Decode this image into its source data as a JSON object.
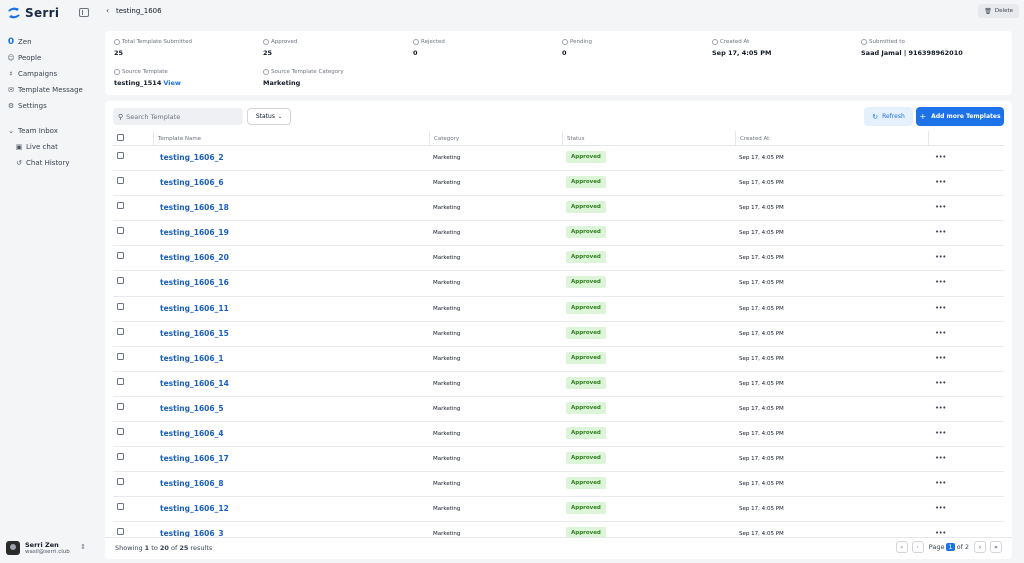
{
  "brand": {
    "name": "Serri",
    "accent": "#1d72e8"
  },
  "sidebar": {
    "items": [
      {
        "label": "Zen",
        "icon": "zen-logo-icon"
      },
      {
        "label": "People",
        "icon": "people-icon"
      },
      {
        "label": "Campaigns",
        "icon": "megaphone-icon"
      },
      {
        "label": "Template Message",
        "icon": "template-icon"
      },
      {
        "label": "Settings",
        "icon": "gear-icon"
      }
    ],
    "group": {
      "label": "Team Inbox",
      "items": [
        {
          "label": "Live chat",
          "icon": "chat-icon"
        },
        {
          "label": "Chat History",
          "icon": "history-icon"
        }
      ]
    },
    "user": {
      "name": "Serri Zen",
      "email": "wasil@serri.club"
    }
  },
  "header": {
    "title": "testing_1606",
    "delete_label": "Delete"
  },
  "summary": {
    "total": {
      "label": "Total Template Submitted",
      "value": "25"
    },
    "approved": {
      "label": "Approved",
      "value": "25"
    },
    "rejected": {
      "label": "Rejected",
      "value": "0"
    },
    "pending": {
      "label": "Pending",
      "value": "0"
    },
    "created": {
      "label": "Created At",
      "value": "Sep 17, 4:05 PM"
    },
    "submitted": {
      "label": "Submitted to",
      "value": "Saad Jamal | 916398962010"
    },
    "source": {
      "label": "Source Template",
      "value": "testing_1514",
      "link": "View"
    },
    "category": {
      "label": "Source Template Category",
      "value": "Marketing"
    }
  },
  "toolbar": {
    "search_placeholder": "Search Template",
    "status_label": "Status",
    "refresh_label": "Refresh",
    "add_label": "Add more Templates"
  },
  "table": {
    "columns": [
      "Template Name",
      "Category",
      "Status",
      "Created At"
    ],
    "rows": [
      {
        "name": "testing_1606_2",
        "category": "Marketing",
        "status": "Approved",
        "created": "Sep 17, 4:05 PM"
      },
      {
        "name": "testing_1606_6",
        "category": "Marketing",
        "status": "Approved",
        "created": "Sep 17, 4:05 PM"
      },
      {
        "name": "testing_1606_18",
        "category": "Marketing",
        "status": "Approved",
        "created": "Sep 17, 4:05 PM"
      },
      {
        "name": "testing_1606_19",
        "category": "Marketing",
        "status": "Approved",
        "created": "Sep 17, 4:05 PM"
      },
      {
        "name": "testing_1606_20",
        "category": "Marketing",
        "status": "Approved",
        "created": "Sep 17, 4:05 PM"
      },
      {
        "name": "testing_1606_16",
        "category": "Marketing",
        "status": "Approved",
        "created": "Sep 17, 4:05 PM"
      },
      {
        "name": "testing_1606_11",
        "category": "Marketing",
        "status": "Approved",
        "created": "Sep 17, 4:05 PM"
      },
      {
        "name": "testing_1606_15",
        "category": "Marketing",
        "status": "Approved",
        "created": "Sep 17, 4:05 PM"
      },
      {
        "name": "testing_1606_1",
        "category": "Marketing",
        "status": "Approved",
        "created": "Sep 17, 4:05 PM"
      },
      {
        "name": "testing_1606_14",
        "category": "Marketing",
        "status": "Approved",
        "created": "Sep 17, 4:05 PM"
      },
      {
        "name": "testing_1606_5",
        "category": "Marketing",
        "status": "Approved",
        "created": "Sep 17, 4:05 PM"
      },
      {
        "name": "testing_1606_4",
        "category": "Marketing",
        "status": "Approved",
        "created": "Sep 17, 4:05 PM"
      },
      {
        "name": "testing_1606_17",
        "category": "Marketing",
        "status": "Approved",
        "created": "Sep 17, 4:05 PM"
      },
      {
        "name": "testing_1606_8",
        "category": "Marketing",
        "status": "Approved",
        "created": "Sep 17, 4:05 PM"
      },
      {
        "name": "testing_1606_12",
        "category": "Marketing",
        "status": "Approved",
        "created": "Sep 17, 4:05 PM"
      },
      {
        "name": "testing_1606_3",
        "category": "Marketing",
        "status": "Approved",
        "created": "Sep 17, 4:05 PM"
      }
    ],
    "row_action_icon": "more-horizontal-icon"
  },
  "footer": {
    "showing_prefix": "Showing",
    "from": "1",
    "to_word": "to",
    "to": "20",
    "of_word": "of",
    "total": "25",
    "suffix": "results",
    "page_word": "Page",
    "page": "1",
    "of_pages_word": "of",
    "pages": "2"
  }
}
